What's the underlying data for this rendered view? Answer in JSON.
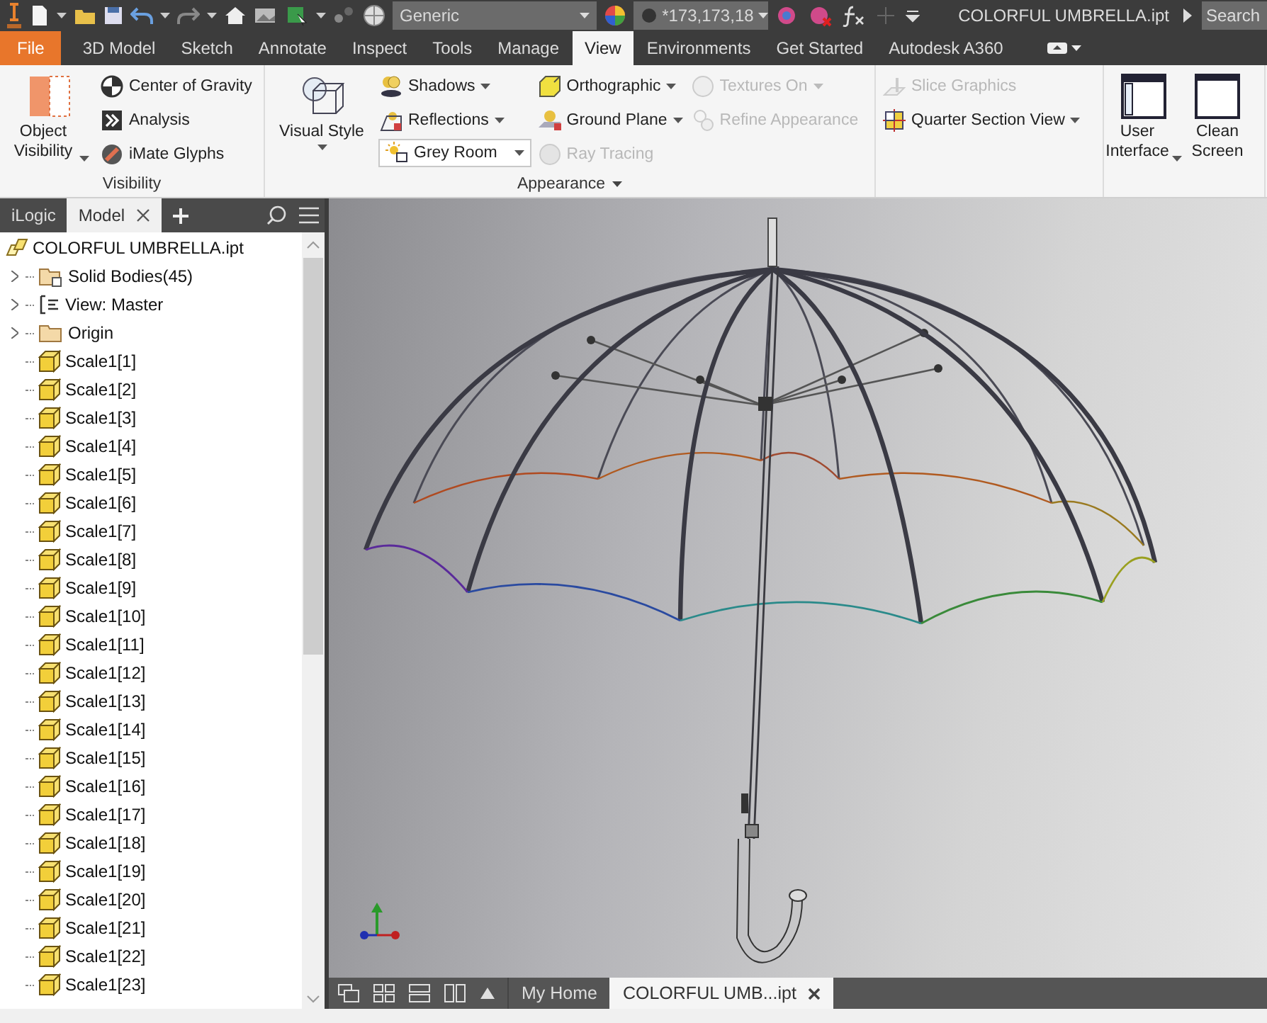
{
  "quick_access": {
    "style_combo": "Generic",
    "appearance_combo": "*173,173,18",
    "document_title": "COLORFUL UMBRELLA.ipt",
    "search": {
      "placeholder": "Search"
    }
  },
  "menu_tabs": [
    {
      "label": "File",
      "kind": "file",
      "selected": false
    },
    {
      "label": "3D Model",
      "kind": "tab",
      "selected": false
    },
    {
      "label": "Sketch",
      "kind": "tab",
      "selected": false
    },
    {
      "label": "Annotate",
      "kind": "tab",
      "selected": false
    },
    {
      "label": "Inspect",
      "kind": "tab",
      "selected": false
    },
    {
      "label": "Tools",
      "kind": "tab",
      "selected": false
    },
    {
      "label": "Manage",
      "kind": "tab",
      "selected": false
    },
    {
      "label": "View",
      "kind": "tab",
      "selected": true
    },
    {
      "label": "Environments",
      "kind": "tab",
      "selected": false
    },
    {
      "label": "Get Started",
      "kind": "tab",
      "selected": false
    },
    {
      "label": "Autodesk A360",
      "kind": "tab",
      "selected": false
    }
  ],
  "ribbon": {
    "panels": [
      {
        "title": "Visibility",
        "title_dropdown": false,
        "columns": [
          [
            {
              "label": "Object Visibility",
              "kind": "large",
              "dropdown": true,
              "disabled": false
            }
          ],
          [
            {
              "label": "Center of Gravity",
              "kind": "small",
              "dropdown": false,
              "disabled": false
            },
            {
              "label": "Analysis",
              "kind": "small",
              "dropdown": false,
              "disabled": false
            },
            {
              "label": "iMate Glyphs",
              "kind": "small",
              "dropdown": false,
              "disabled": false
            }
          ]
        ]
      },
      {
        "title": "Appearance",
        "title_dropdown": true,
        "columns": [
          [
            {
              "label": "Visual Style",
              "kind": "large",
              "dropdown": true,
              "disabled": false
            }
          ],
          [
            {
              "label": "Shadows",
              "kind": "small",
              "dropdown": true,
              "disabled": false
            },
            {
              "label": "Reflections",
              "kind": "small",
              "dropdown": true,
              "disabled": false
            },
            {
              "label": "Grey Room",
              "kind": "combo",
              "dropdown": true,
              "disabled": false
            }
          ],
          [
            {
              "label": "Orthographic",
              "kind": "small",
              "dropdown": true,
              "disabled": false
            },
            {
              "label": "Ground Plane",
              "kind": "small",
              "dropdown": true,
              "disabled": false
            },
            {
              "label": "Ray Tracing",
              "kind": "small",
              "dropdown": false,
              "disabled": true
            }
          ],
          [
            {
              "label": "Textures On",
              "kind": "small",
              "dropdown": true,
              "disabled": true
            },
            {
              "label": "Refine Appearance",
              "kind": "small",
              "dropdown": false,
              "disabled": true
            }
          ]
        ]
      },
      {
        "columns": [
          [
            {
              "label": "Slice Graphics",
              "kind": "small",
              "dropdown": false,
              "disabled": true
            },
            {
              "label": "Quarter Section View",
              "kind": "small",
              "dropdown": true,
              "disabled": false
            }
          ]
        ]
      },
      {
        "columns": [
          [
            {
              "label": "User Interface",
              "kind": "large",
              "dropdown": true,
              "disabled": false
            }
          ],
          [
            {
              "label": "Clean Screen",
              "kind": "large",
              "dropdown": false,
              "disabled": false
            }
          ]
        ]
      }
    ]
  },
  "browser": {
    "tabs": [
      {
        "label": "iLogic",
        "selected": false,
        "closable": false
      },
      {
        "label": "Model",
        "selected": true,
        "closable": true
      }
    ],
    "tree": {
      "label": "COLORFUL UMBRELLA.ipt",
      "kind": "part",
      "children": [
        {
          "label": "Solid Bodies(45)",
          "kind": "bodies",
          "collapsed": true
        },
        {
          "label": "View: Master",
          "kind": "view",
          "collapsed": true
        },
        {
          "label": "Origin",
          "kind": "folder",
          "collapsed": true
        },
        {
          "label": "Scale1[1]",
          "kind": "body",
          "collapsed": false
        },
        {
          "label": "Scale1[2]",
          "kind": "body",
          "collapsed": false
        },
        {
          "label": "Scale1[3]",
          "kind": "body",
          "collapsed": false
        },
        {
          "label": "Scale1[4]",
          "kind": "body",
          "collapsed": false
        },
        {
          "label": "Scale1[5]",
          "kind": "body",
          "collapsed": false
        },
        {
          "label": "Scale1[6]",
          "kind": "body",
          "collapsed": false
        },
        {
          "label": "Scale1[7]",
          "kind": "body",
          "collapsed": false
        },
        {
          "label": "Scale1[8]",
          "kind": "body",
          "collapsed": false
        },
        {
          "label": "Scale1[9]",
          "kind": "body",
          "collapsed": false
        },
        {
          "label": "Scale1[10]",
          "kind": "body",
          "collapsed": false
        },
        {
          "label": "Scale1[11]",
          "kind": "body",
          "collapsed": false
        },
        {
          "label": "Scale1[12]",
          "kind": "body",
          "collapsed": false
        },
        {
          "label": "Scale1[13]",
          "kind": "body",
          "collapsed": false
        },
        {
          "label": "Scale1[14]",
          "kind": "body",
          "collapsed": false
        },
        {
          "label": "Scale1[15]",
          "kind": "body",
          "collapsed": false
        },
        {
          "label": "Scale1[16]",
          "kind": "body",
          "collapsed": false
        },
        {
          "label": "Scale1[17]",
          "kind": "body",
          "collapsed": false
        },
        {
          "label": "Scale1[18]",
          "kind": "body",
          "collapsed": false
        },
        {
          "label": "Scale1[19]",
          "kind": "body",
          "collapsed": false
        },
        {
          "label": "Scale1[20]",
          "kind": "body",
          "collapsed": false
        },
        {
          "label": "Scale1[21]",
          "kind": "body",
          "collapsed": false
        },
        {
          "label": "Scale1[22]",
          "kind": "body",
          "collapsed": false
        },
        {
          "label": "Scale1[23]",
          "kind": "body",
          "collapsed": false
        }
      ]
    }
  },
  "document_tabs": [
    {
      "label": "My Home",
      "selected": false,
      "closable": false
    },
    {
      "label": "COLORFUL UMB...ipt",
      "selected": true,
      "closable": true
    }
  ]
}
